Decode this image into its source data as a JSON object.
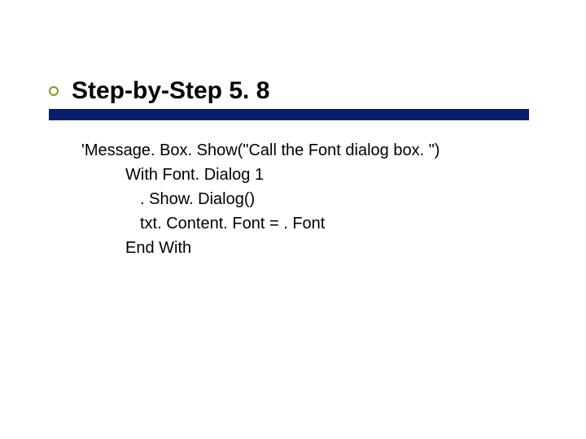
{
  "title": "Step-by-Step 5. 8",
  "colors": {
    "underline": "#0b1e6b",
    "bullet_border": "#7a9a2e"
  },
  "code": {
    "lines": [
      "'Message. Box. Show(\"Call the Font dialog box. \")",
      "With Font. Dialog 1",
      ". Show. Dialog()",
      "txt. Content. Font = . Font",
      "End With"
    ]
  }
}
